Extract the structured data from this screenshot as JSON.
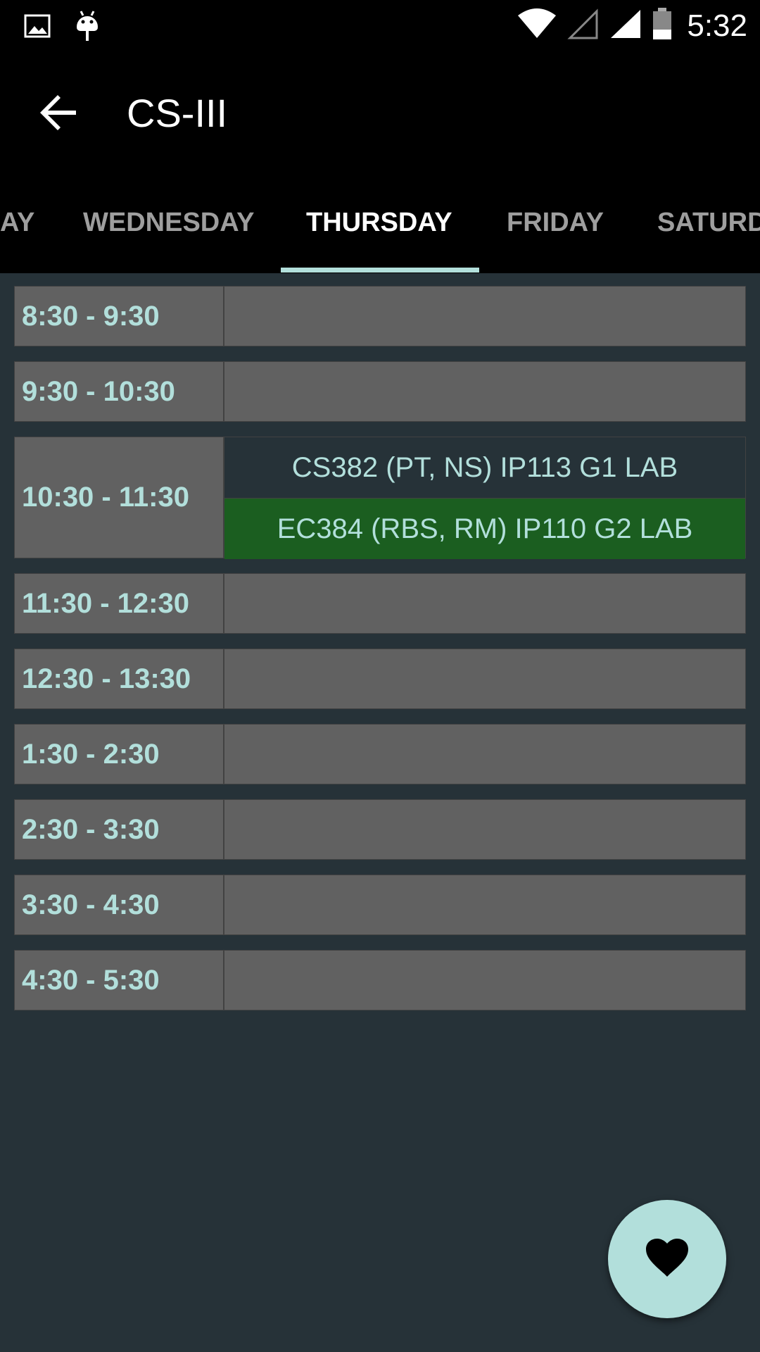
{
  "status_bar": {
    "time": "5:32",
    "icons": [
      "image-icon",
      "android-icon",
      "wifi-icon",
      "signal-empty-icon",
      "signal-icon",
      "battery-icon"
    ]
  },
  "app_bar": {
    "title": "CS-III",
    "back_icon": "arrow-back-icon"
  },
  "tabs": [
    {
      "label": "AY",
      "active": false
    },
    {
      "label": "WEDNESDAY",
      "active": false
    },
    {
      "label": "THURSDAY",
      "active": true
    },
    {
      "label": "FRIDAY",
      "active": false
    },
    {
      "label": "SATURD",
      "active": false
    }
  ],
  "timetable": {
    "rows": [
      {
        "time": "8:30 - 9:30",
        "entries": []
      },
      {
        "time": "9:30 - 10:30",
        "entries": []
      },
      {
        "time": "10:30 - 11:30",
        "entries": [
          {
            "text": "CS382 (PT, NS) IP113 G1 LAB"
          },
          {
            "text": "EC384 (RBS, RM) IP110 G2 LAB"
          }
        ]
      },
      {
        "time": "11:30 - 12:30",
        "entries": []
      },
      {
        "time": "12:30 - 13:30",
        "entries": []
      },
      {
        "time": "1:30 - 2:30",
        "entries": []
      },
      {
        "time": "2:30 - 3:30",
        "entries": []
      },
      {
        "time": "3:30 - 4:30",
        "entries": []
      },
      {
        "time": "4:30 - 5:30",
        "entries": []
      }
    ]
  },
  "fab": {
    "icon": "heart-icon"
  },
  "colors": {
    "background": "#263238",
    "bar": "#000000",
    "accent": "#b2dfdb",
    "cell": "#616161",
    "green_entry": "#1b5e20"
  }
}
